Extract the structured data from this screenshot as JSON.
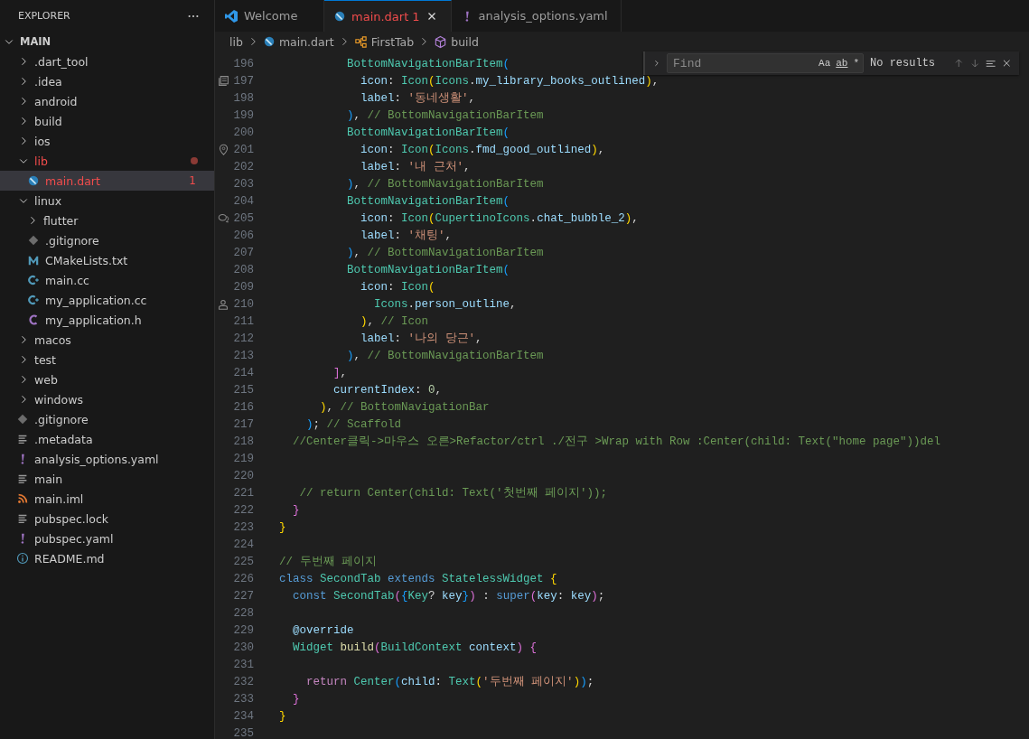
{
  "sidebar": {
    "title": "EXPLORER",
    "section": {
      "label": "MAIN",
      "expanded": true
    },
    "tree": [
      {
        "label": ".dart_tool",
        "kind": "folder",
        "expanded": false
      },
      {
        "label": ".idea",
        "kind": "folder",
        "expanded": false
      },
      {
        "label": "android",
        "kind": "folder",
        "expanded": false
      },
      {
        "label": "build",
        "kind": "folder",
        "expanded": false
      },
      {
        "label": "ios",
        "kind": "folder",
        "expanded": false
      },
      {
        "label": "lib",
        "kind": "folder",
        "expanded": true,
        "error": true,
        "children": [
          {
            "label": "main.dart",
            "kind": "dart",
            "error": true,
            "selected": true,
            "badge": "1"
          }
        ]
      },
      {
        "label": "linux",
        "kind": "folder",
        "expanded": true,
        "children": [
          {
            "label": "flutter",
            "kind": "folder",
            "expanded": false
          },
          {
            "label": ".gitignore",
            "kind": "git"
          },
          {
            "label": "CMakeLists.txt",
            "kind": "cmake"
          },
          {
            "label": "main.cc",
            "kind": "cpp"
          },
          {
            "label": "my_application.cc",
            "kind": "cpp"
          },
          {
            "label": "my_application.h",
            "kind": "c"
          }
        ]
      },
      {
        "label": "macos",
        "kind": "folder",
        "expanded": false
      },
      {
        "label": "test",
        "kind": "folder",
        "expanded": false
      },
      {
        "label": "web",
        "kind": "folder",
        "expanded": false
      },
      {
        "label": "windows",
        "kind": "folder",
        "expanded": false
      },
      {
        "label": ".gitignore",
        "kind": "git"
      },
      {
        "label": ".metadata",
        "kind": "lines"
      },
      {
        "label": "analysis_options.yaml",
        "kind": "yaml"
      },
      {
        "label": "main",
        "kind": "lines"
      },
      {
        "label": "main.iml",
        "kind": "rss"
      },
      {
        "label": "pubspec.lock",
        "kind": "lines"
      },
      {
        "label": "pubspec.yaml",
        "kind": "yaml"
      },
      {
        "label": "README.md",
        "kind": "info"
      }
    ]
  },
  "tabs": [
    {
      "label": "Welcome",
      "kind": "vscode",
      "selected": false
    },
    {
      "label": "main.dart",
      "kind": "dart",
      "selected": true,
      "error": true,
      "badge": "1"
    },
    {
      "label": "analysis_options.yaml",
      "kind": "yaml",
      "selected": false
    }
  ],
  "breadcrumbs": [
    {
      "label": "lib",
      "kind": "folder"
    },
    {
      "label": "main.dart",
      "kind": "dart"
    },
    {
      "label": "FirstTab",
      "kind": "class"
    },
    {
      "label": "build",
      "kind": "method"
    }
  ],
  "find_widget": {
    "placeholder": "Find",
    "options": [
      "Aa",
      "ab",
      "*"
    ],
    "result": "No results"
  },
  "code": [
    {
      "number": "196",
      "tokens": [
        {
          "t": "          BottomNavigationBarItem",
          "kind": "ty"
        },
        {
          "t": "(",
          "kind": "b3"
        }
      ]
    },
    {
      "number": "197",
      "kind": "book",
      "tokens": [
        {
          "t": "            icon",
          "kind": "va"
        },
        {
          "t": ": ",
          "kind": "p"
        },
        {
          "t": "Icon",
          "kind": "ty"
        },
        {
          "t": "(",
          "kind": "b1"
        },
        {
          "t": "Icons",
          "kind": "ty"
        },
        {
          "t": ".",
          "kind": "p"
        },
        {
          "t": "my_library_books_outlined",
          "kind": "va"
        },
        {
          "t": ")",
          "kind": "b1"
        },
        {
          "t": ",",
          "kind": "p"
        }
      ]
    },
    {
      "number": "198",
      "tokens": [
        {
          "t": "            label",
          "kind": "va"
        },
        {
          "t": ": ",
          "kind": "p"
        },
        {
          "t": "'동네생활'",
          "kind": "st"
        },
        {
          "t": ",",
          "kind": "p"
        }
      ]
    },
    {
      "number": "199",
      "tokens": [
        {
          "t": "          )",
          "kind": "b3"
        },
        {
          "t": ", ",
          "kind": "p"
        },
        {
          "t": "// BottomNavigationBarItem",
          "kind": "cm"
        }
      ]
    },
    {
      "number": "200",
      "tokens": [
        {
          "t": "          BottomNavigationBarItem",
          "kind": "ty"
        },
        {
          "t": "(",
          "kind": "b3"
        }
      ]
    },
    {
      "number": "201",
      "kind": "pin",
      "tokens": [
        {
          "t": "            icon",
          "kind": "va"
        },
        {
          "t": ": ",
          "kind": "p"
        },
        {
          "t": "Icon",
          "kind": "ty"
        },
        {
          "t": "(",
          "kind": "b1"
        },
        {
          "t": "Icons",
          "kind": "ty"
        },
        {
          "t": ".",
          "kind": "p"
        },
        {
          "t": "fmd_good_outlined",
          "kind": "va"
        },
        {
          "t": ")",
          "kind": "b1"
        },
        {
          "t": ",",
          "kind": "p"
        }
      ]
    },
    {
      "number": "202",
      "tokens": [
        {
          "t": "            label",
          "kind": "va"
        },
        {
          "t": ": ",
          "kind": "p"
        },
        {
          "t": "'내 근처'",
          "kind": "st"
        },
        {
          "t": ",",
          "kind": "p"
        }
      ]
    },
    {
      "number": "203",
      "tokens": [
        {
          "t": "          )",
          "kind": "b3"
        },
        {
          "t": ", ",
          "kind": "p"
        },
        {
          "t": "// BottomNavigationBarItem",
          "kind": "cm"
        }
      ]
    },
    {
      "number": "204",
      "tokens": [
        {
          "t": "          BottomNavigationBarItem",
          "kind": "ty"
        },
        {
          "t": "(",
          "kind": "b3"
        }
      ]
    },
    {
      "number": "205",
      "kind": "chat",
      "tokens": [
        {
          "t": "            icon",
          "kind": "va"
        },
        {
          "t": ": ",
          "kind": "p"
        },
        {
          "t": "Icon",
          "kind": "ty"
        },
        {
          "t": "(",
          "kind": "b1"
        },
        {
          "t": "CupertinoIcons",
          "kind": "ty"
        },
        {
          "t": ".",
          "kind": "p"
        },
        {
          "t": "chat_bubble_2",
          "kind": "va"
        },
        {
          "t": ")",
          "kind": "b1"
        },
        {
          "t": ",",
          "kind": "p"
        }
      ]
    },
    {
      "number": "206",
      "tokens": [
        {
          "t": "            label",
          "kind": "va"
        },
        {
          "t": ": ",
          "kind": "p"
        },
        {
          "t": "'채팅'",
          "kind": "st"
        },
        {
          "t": ",",
          "kind": "p"
        }
      ]
    },
    {
      "number": "207",
      "tokens": [
        {
          "t": "          )",
          "kind": "b3"
        },
        {
          "t": ", ",
          "kind": "p"
        },
        {
          "t": "// BottomNavigationBarItem",
          "kind": "cm"
        }
      ]
    },
    {
      "number": "208",
      "tokens": [
        {
          "t": "          BottomNavigationBarItem",
          "kind": "ty"
        },
        {
          "t": "(",
          "kind": "b3"
        }
      ]
    },
    {
      "number": "209",
      "tokens": [
        {
          "t": "            icon",
          "kind": "va"
        },
        {
          "t": ": ",
          "kind": "p"
        },
        {
          "t": "Icon",
          "kind": "ty"
        },
        {
          "t": "(",
          "kind": "b1"
        }
      ]
    },
    {
      "number": "210",
      "kind": "person",
      "tokens": [
        {
          "t": "              Icons",
          "kind": "ty"
        },
        {
          "t": ".",
          "kind": "p"
        },
        {
          "t": "person_outline",
          "kind": "va"
        },
        {
          "t": ",",
          "kind": "p"
        }
      ]
    },
    {
      "number": "211",
      "tokens": [
        {
          "t": "            )",
          "kind": "b1"
        },
        {
          "t": ", ",
          "kind": "p"
        },
        {
          "t": "// Icon",
          "kind": "cm"
        }
      ]
    },
    {
      "number": "212",
      "tokens": [
        {
          "t": "            label",
          "kind": "va"
        },
        {
          "t": ": ",
          "kind": "p"
        },
        {
          "t": "'나의 당근'",
          "kind": "st"
        },
        {
          "t": ",",
          "kind": "p"
        }
      ]
    },
    {
      "number": "213",
      "tokens": [
        {
          "t": "          )",
          "kind": "b3"
        },
        {
          "t": ", ",
          "kind": "p"
        },
        {
          "t": "// BottomNavigationBarItem",
          "kind": "cm"
        }
      ]
    },
    {
      "number": "214",
      "tokens": [
        {
          "t": "        ]",
          "kind": "b2"
        },
        {
          "t": ",",
          "kind": "p"
        }
      ]
    },
    {
      "number": "215",
      "tokens": [
        {
          "t": "        currentIndex",
          "kind": "va"
        },
        {
          "t": ": ",
          "kind": "p"
        },
        {
          "t": "0",
          "kind": "nu"
        },
        {
          "t": ",",
          "kind": "p"
        }
      ]
    },
    {
      "number": "216",
      "tokens": [
        {
          "t": "      )",
          "kind": "b1"
        },
        {
          "t": ", ",
          "kind": "p"
        },
        {
          "t": "// BottomNavigationBar",
          "kind": "cm"
        }
      ]
    },
    {
      "number": "217",
      "tokens": [
        {
          "t": "    )",
          "kind": "b3"
        },
        {
          "t": "; ",
          "kind": "p"
        },
        {
          "t": "// Scaffold",
          "kind": "cm"
        }
      ]
    },
    {
      "number": "218",
      "tokens": [
        {
          "t": "  //Center클릭->마우스 오른>Refactor/ctrl ./전구 >Wrap with Row :Center(child: Text(\"home page\"))del",
          "kind": "cm"
        }
      ]
    },
    {
      "number": "219"
    },
    {
      "number": "220"
    },
    {
      "number": "221",
      "tokens": [
        {
          "t": "   // return Center(child: Text('첫번째 페이지'));",
          "kind": "cm"
        }
      ]
    },
    {
      "number": "222",
      "tokens": [
        {
          "t": "  }",
          "kind": "b2"
        }
      ]
    },
    {
      "number": "223",
      "tokens": [
        {
          "t": "}",
          "kind": "b1"
        }
      ]
    },
    {
      "number": "224"
    },
    {
      "number": "225",
      "tokens": [
        {
          "t": "// 두번째 페이지",
          "kind": "cm"
        }
      ]
    },
    {
      "number": "226",
      "tokens": [
        {
          "t": "class",
          "kind": "kw"
        },
        {
          "t": " SecondTab",
          "kind": "ty"
        },
        {
          "t": " extends",
          "kind": "kw"
        },
        {
          "t": " StatelessWidget",
          "kind": "ty"
        },
        {
          "t": " {",
          "kind": "b1"
        }
      ]
    },
    {
      "number": "227",
      "tokens": [
        {
          "t": "  const",
          "kind": "kw"
        },
        {
          "t": " SecondTab",
          "kind": "ty"
        },
        {
          "t": "(",
          "kind": "b2"
        },
        {
          "t": "{",
          "kind": "b3"
        },
        {
          "t": "Key",
          "kind": "ty"
        },
        {
          "t": "? ",
          "kind": "p"
        },
        {
          "t": "key",
          "kind": "va"
        },
        {
          "t": "}",
          "kind": "b3"
        },
        {
          "t": ")",
          "kind": "b2"
        },
        {
          "t": " : ",
          "kind": "p"
        },
        {
          "t": "super",
          "kind": "kw"
        },
        {
          "t": "(",
          "kind": "b2"
        },
        {
          "t": "key",
          "kind": "va"
        },
        {
          "t": ": ",
          "kind": "p"
        },
        {
          "t": "key",
          "kind": "va"
        },
        {
          "t": ")",
          "kind": "b2"
        },
        {
          "t": ";",
          "kind": "p"
        }
      ]
    },
    {
      "number": "228"
    },
    {
      "number": "229",
      "tokens": [
        {
          "t": "  @override",
          "kind": "va"
        }
      ]
    },
    {
      "number": "230",
      "tokens": [
        {
          "t": "  Widget",
          "kind": "ty"
        },
        {
          "t": " build",
          "kind": "fn"
        },
        {
          "t": "(",
          "kind": "b2"
        },
        {
          "t": "BuildContext",
          "kind": "ty"
        },
        {
          "t": " context",
          "kind": "va"
        },
        {
          "t": ")",
          "kind": "b2"
        },
        {
          "t": " {",
          "kind": "b2"
        }
      ]
    },
    {
      "number": "231"
    },
    {
      "number": "232",
      "tokens": [
        {
          "t": "    return",
          "kind": "ck"
        },
        {
          "t": " Center",
          "kind": "ty"
        },
        {
          "t": "(",
          "kind": "b3"
        },
        {
          "t": "child",
          "kind": "va"
        },
        {
          "t": ": ",
          "kind": "p"
        },
        {
          "t": "Text",
          "kind": "ty"
        },
        {
          "t": "(",
          "kind": "b1"
        },
        {
          "t": "'두번째 페이지'",
          "kind": "st"
        },
        {
          "t": ")",
          "kind": "b1"
        },
        {
          "t": ")",
          "kind": "b3"
        },
        {
          "t": ";",
          "kind": "p"
        }
      ]
    },
    {
      "number": "233",
      "tokens": [
        {
          "t": "  }",
          "kind": "b2"
        }
      ]
    },
    {
      "number": "234",
      "tokens": [
        {
          "t": "}",
          "kind": "b1"
        }
      ]
    },
    {
      "number": "235"
    }
  ]
}
